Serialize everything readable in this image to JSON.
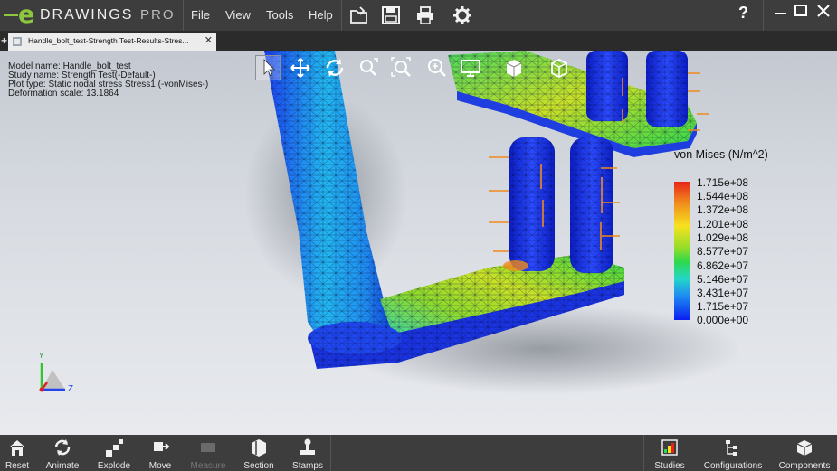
{
  "app": {
    "logo_mark": "e",
    "logo_name": "DRAWINGS",
    "logo_edition": "PRO"
  },
  "menu": {
    "items": [
      {
        "label": "File"
      },
      {
        "label": "View"
      },
      {
        "label": "Tools"
      },
      {
        "label": "Help"
      }
    ],
    "toolbar_icons": [
      "open-icon",
      "save-icon",
      "print-icon",
      "settings-gear-icon"
    ],
    "help_label": "?",
    "window_buttons": [
      "minimize",
      "maximize",
      "close"
    ]
  },
  "tab": {
    "add_label": "+",
    "title": "Handle_bolt_test-Strength Test-Results-Stres...",
    "close_label": "✕"
  },
  "info": {
    "model": "Model name: Handle_bolt_test",
    "study": "Study name: Strength Test(-Default-)",
    "plot": "Plot type: Static nodal stress Stress1 (-vonMises-)",
    "deformation": "Deformation scale: 13.1864"
  },
  "view_tools": [
    "select-cursor-icon",
    "pan-icon",
    "rotate-icon",
    "zoom-to-area-icon",
    "zoom-to-fit-icon",
    "zoom-in-out-icon",
    "display-style-icon",
    "shaded-icon",
    "view-orientation-icon"
  ],
  "legend": {
    "title": "von Mises (N/m^2)",
    "values": [
      "1.715e+08",
      "1.544e+08",
      "1.372e+08",
      "1.201e+08",
      "1.029e+08",
      "8.577e+07",
      "6.862e+07",
      "5.146e+07",
      "3.431e+07",
      "1.715e+07",
      "0.000e+00"
    ],
    "color_stops": [
      "#e8241a",
      "#f08a1c",
      "#f6e21f",
      "#93dd2a",
      "#2ed84c",
      "#24d7c6",
      "#1e8ff0",
      "#0a1ef2"
    ]
  },
  "triad": {
    "y_label": "Y",
    "z_label": "Z"
  },
  "bottom_toolbar": {
    "left": [
      {
        "label": "Reset",
        "icon": "home-icon",
        "enabled": true
      },
      {
        "label": "Animate",
        "icon": "animate-icon",
        "enabled": true
      },
      {
        "label": "Explode",
        "icon": "explode-icon",
        "enabled": true
      },
      {
        "label": "Move",
        "icon": "move-icon",
        "enabled": true
      },
      {
        "label": "Measure",
        "icon": "measure-icon",
        "enabled": false
      },
      {
        "label": "Section",
        "icon": "section-icon",
        "enabled": true
      },
      {
        "label": "Stamps",
        "icon": "stamps-icon",
        "enabled": true
      }
    ],
    "right": [
      {
        "label": "Studies",
        "icon": "studies-icon",
        "enabled": true
      },
      {
        "label": "Configurations",
        "icon": "configurations-icon",
        "enabled": true
      },
      {
        "label": "Components",
        "icon": "components-icon",
        "enabled": true
      }
    ]
  },
  "colors": {
    "brand_green": "#8dc63f",
    "bar_bg": "#3d3d3d",
    "mesh_blue": "#1f3fd8"
  }
}
